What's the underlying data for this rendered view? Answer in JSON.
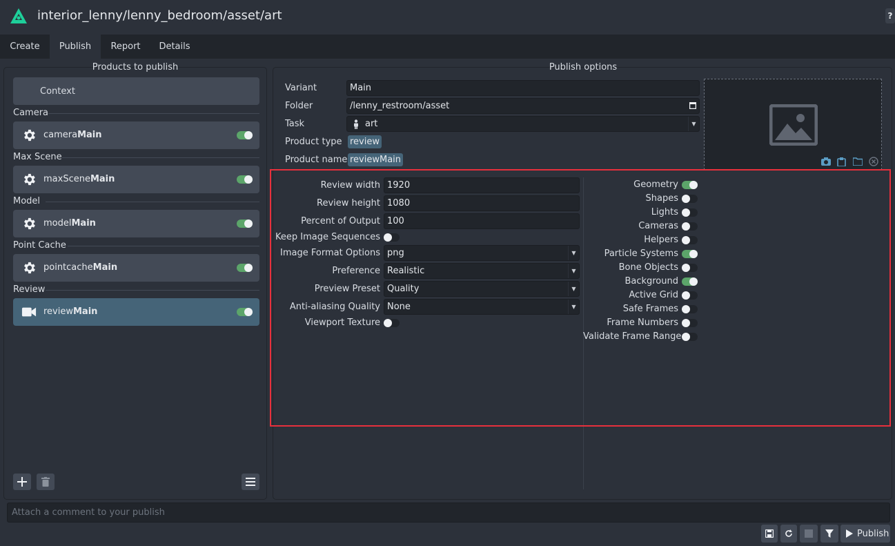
{
  "window": {
    "title": "interior_lenny/lenny_bedroom/asset/art",
    "help_label": "?"
  },
  "tabs": [
    {
      "label": "Create"
    },
    {
      "label": "Publish",
      "active": true
    },
    {
      "label": "Report"
    },
    {
      "label": "Details"
    }
  ],
  "products_panel": {
    "title": "Products to publish",
    "context_label": "Context",
    "groups": [
      {
        "label": "Camera",
        "item": {
          "prefix": "camera",
          "bold": "Main",
          "enabled": true,
          "icon": "gear-icon"
        }
      },
      {
        "label": "Max Scene",
        "item": {
          "prefix": "maxScene",
          "bold": "Main",
          "enabled": true,
          "icon": "gear-icon"
        }
      },
      {
        "label": "Model",
        "item": {
          "prefix": "model",
          "bold": "Main",
          "enabled": true,
          "icon": "gear-icon"
        }
      },
      {
        "label": "Point Cache",
        "item": {
          "prefix": "pointcache",
          "bold": "Main",
          "enabled": true,
          "icon": "gear-icon"
        }
      },
      {
        "label": "Review",
        "item": {
          "prefix": "review",
          "bold": "Main",
          "enabled": true,
          "icon": "video-camera-icon",
          "selected": true
        }
      }
    ]
  },
  "options_panel": {
    "title": "Publish options",
    "variant": {
      "label": "Variant",
      "value": "Main"
    },
    "folder": {
      "label": "Folder",
      "value": "/lenny_restroom/asset"
    },
    "task": {
      "label": "Task",
      "value": "art"
    },
    "product_type": {
      "label": "Product type",
      "value": "review"
    },
    "product_name": {
      "label": "Product name",
      "value": "reviewMain"
    }
  },
  "review_settings": {
    "review_width": {
      "label": "Review width",
      "value": "1920"
    },
    "review_height": {
      "label": "Review height",
      "value": "1080"
    },
    "percent_output": {
      "label": "Percent of Output",
      "value": "100"
    },
    "keep_image_sequences": {
      "label": "Keep Image Sequences",
      "enabled": false
    },
    "image_format": {
      "label": "Image Format Options",
      "value": "png"
    },
    "preference": {
      "label": "Preference",
      "value": "Realistic"
    },
    "preview_preset": {
      "label": "Preview Preset",
      "value": "Quality"
    },
    "anti_aliasing": {
      "label": "Anti-aliasing Quality",
      "value": "None"
    },
    "viewport_texture": {
      "label": "Viewport Texture",
      "enabled": false
    }
  },
  "visibility": [
    {
      "label": "Geometry",
      "enabled": true
    },
    {
      "label": "Shapes",
      "enabled": false
    },
    {
      "label": "Lights",
      "enabled": false
    },
    {
      "label": "Cameras",
      "enabled": false
    },
    {
      "label": "Helpers",
      "enabled": false
    },
    {
      "label": "Particle Systems",
      "enabled": true
    },
    {
      "label": "Bone Objects",
      "enabled": false
    },
    {
      "label": "Background",
      "enabled": true
    },
    {
      "label": "Active Grid",
      "enabled": false
    },
    {
      "label": "Safe Frames",
      "enabled": false
    },
    {
      "label": "Frame Numbers",
      "enabled": false
    },
    {
      "label": "Validate Frame Range",
      "enabled": false
    }
  ],
  "comment": {
    "placeholder": "Attach a comment to your publish"
  },
  "footer": {
    "publish_label": "Publish"
  },
  "colors": {
    "background": "#2c313a",
    "accent_green": "#5ca56a",
    "selection_blue": "#456478",
    "highlight_red": "#e8303c",
    "logo_teal": "#1ecf9a"
  }
}
